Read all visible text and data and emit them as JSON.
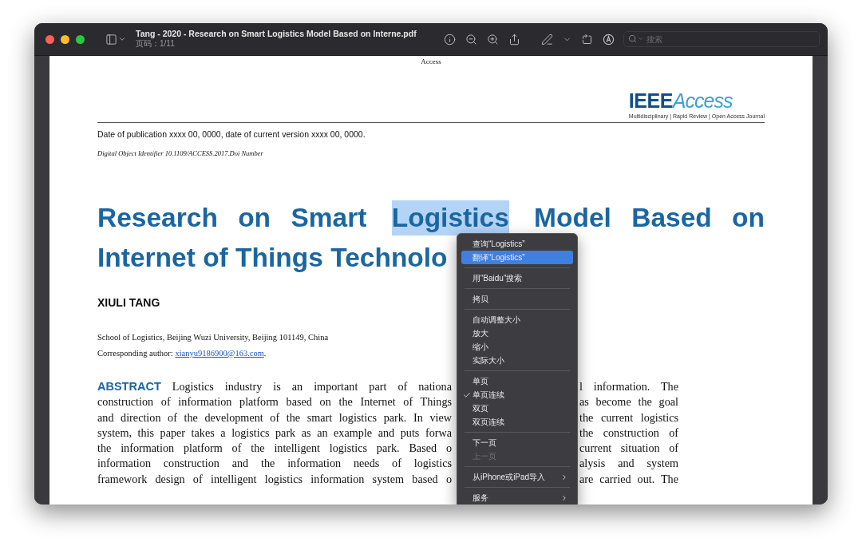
{
  "window": {
    "title": "Tang - 2020 - Research on Smart Logistics Model Based on Interne.pdf",
    "subtitle": "页码：1/11"
  },
  "toolbar": {
    "search": {
      "placeholder": "搜索"
    }
  },
  "page": {
    "running_head": "Access",
    "logo": {
      "brand": "IEEE",
      "name": "Access",
      "tagline": "Multidisciplinary | Rapid Review | Open Access Journal"
    },
    "dates": "Date of publication xxxx 00, 0000, date of current version xxxx 00, 0000.",
    "doi": "Digital Object Identifier 10.1109/ACCESS.2017.Doi Number",
    "title_line_1": [
      {
        "text": "Research on Smart",
        "selected": false
      },
      {
        "text": "Logistics",
        "selected": true
      },
      {
        "text": "Model Based on",
        "selected": false
      }
    ],
    "title_line_2": "Internet of Things Technolo",
    "author": "XIULI TANG",
    "affiliation": "School of Logistics, Beijing Wuzi University, Beijing 101149, China",
    "corresponding": {
      "label": "Corresponding author: ",
      "email": "xianyu9186900@163.com",
      "end": "."
    },
    "abstract": {
      "heading": "ABSTRACT",
      "lines": [
        {
          "left": "Logistics industry is an important part of nationa",
          "right": "l information. The"
        },
        {
          "left": "construction of information platform based on the Internet of Things",
          "right": "as become the goal"
        },
        {
          "left": "and direction of the development of the smart logistics park. In view",
          "right": "the current logistics"
        },
        {
          "left": "system, this paper takes a logistics park as an example and puts forwa",
          "right": "the construction of"
        },
        {
          "left": "the information platform of the intelligent logistics park. Based o",
          "right": "current situation of"
        },
        {
          "left": "information construction and the information needs of logistics",
          "right": "alysis and system"
        },
        {
          "left": "framework design of intelligent logistics information system based o",
          "right": "are carried out. The"
        }
      ]
    }
  },
  "context_menu": {
    "sections": [
      [
        {
          "label": "查询“Logistics”",
          "highlighted": false,
          "checked": false,
          "disabled": false,
          "submenu": false
        },
        {
          "label": "翻译“Logistics”",
          "highlighted": true,
          "checked": false,
          "disabled": false,
          "submenu": false
        }
      ],
      [
        {
          "label": "用“Baidu”搜索",
          "highlighted": false,
          "checked": false,
          "disabled": false,
          "submenu": false
        }
      ],
      [
        {
          "label": "拷贝",
          "highlighted": false,
          "checked": false,
          "disabled": false,
          "submenu": false
        }
      ],
      [
        {
          "label": "自动调整大小",
          "highlighted": false,
          "checked": false,
          "disabled": false,
          "submenu": false
        },
        {
          "label": "放大",
          "highlighted": false,
          "checked": false,
          "disabled": false,
          "submenu": false
        },
        {
          "label": "缩小",
          "highlighted": false,
          "checked": false,
          "disabled": false,
          "submenu": false
        },
        {
          "label": "实际大小",
          "highlighted": false,
          "checked": false,
          "disabled": false,
          "submenu": false
        }
      ],
      [
        {
          "label": "单页",
          "highlighted": false,
          "checked": false,
          "disabled": false,
          "submenu": false
        },
        {
          "label": "单页连续",
          "highlighted": false,
          "checked": true,
          "disabled": false,
          "submenu": false
        },
        {
          "label": "双页",
          "highlighted": false,
          "checked": false,
          "disabled": false,
          "submenu": false
        },
        {
          "label": "双页连续",
          "highlighted": false,
          "checked": false,
          "disabled": false,
          "submenu": false
        }
      ],
      [
        {
          "label": "下一页",
          "highlighted": false,
          "checked": false,
          "disabled": false,
          "submenu": false
        },
        {
          "label": "上一页",
          "highlighted": false,
          "checked": false,
          "disabled": true,
          "submenu": false
        }
      ],
      [
        {
          "label": "从iPhone或iPad导入",
          "highlighted": false,
          "checked": false,
          "disabled": false,
          "submenu": true
        }
      ],
      [
        {
          "label": "服务",
          "highlighted": false,
          "checked": false,
          "disabled": false,
          "submenu": true
        }
      ]
    ]
  }
}
